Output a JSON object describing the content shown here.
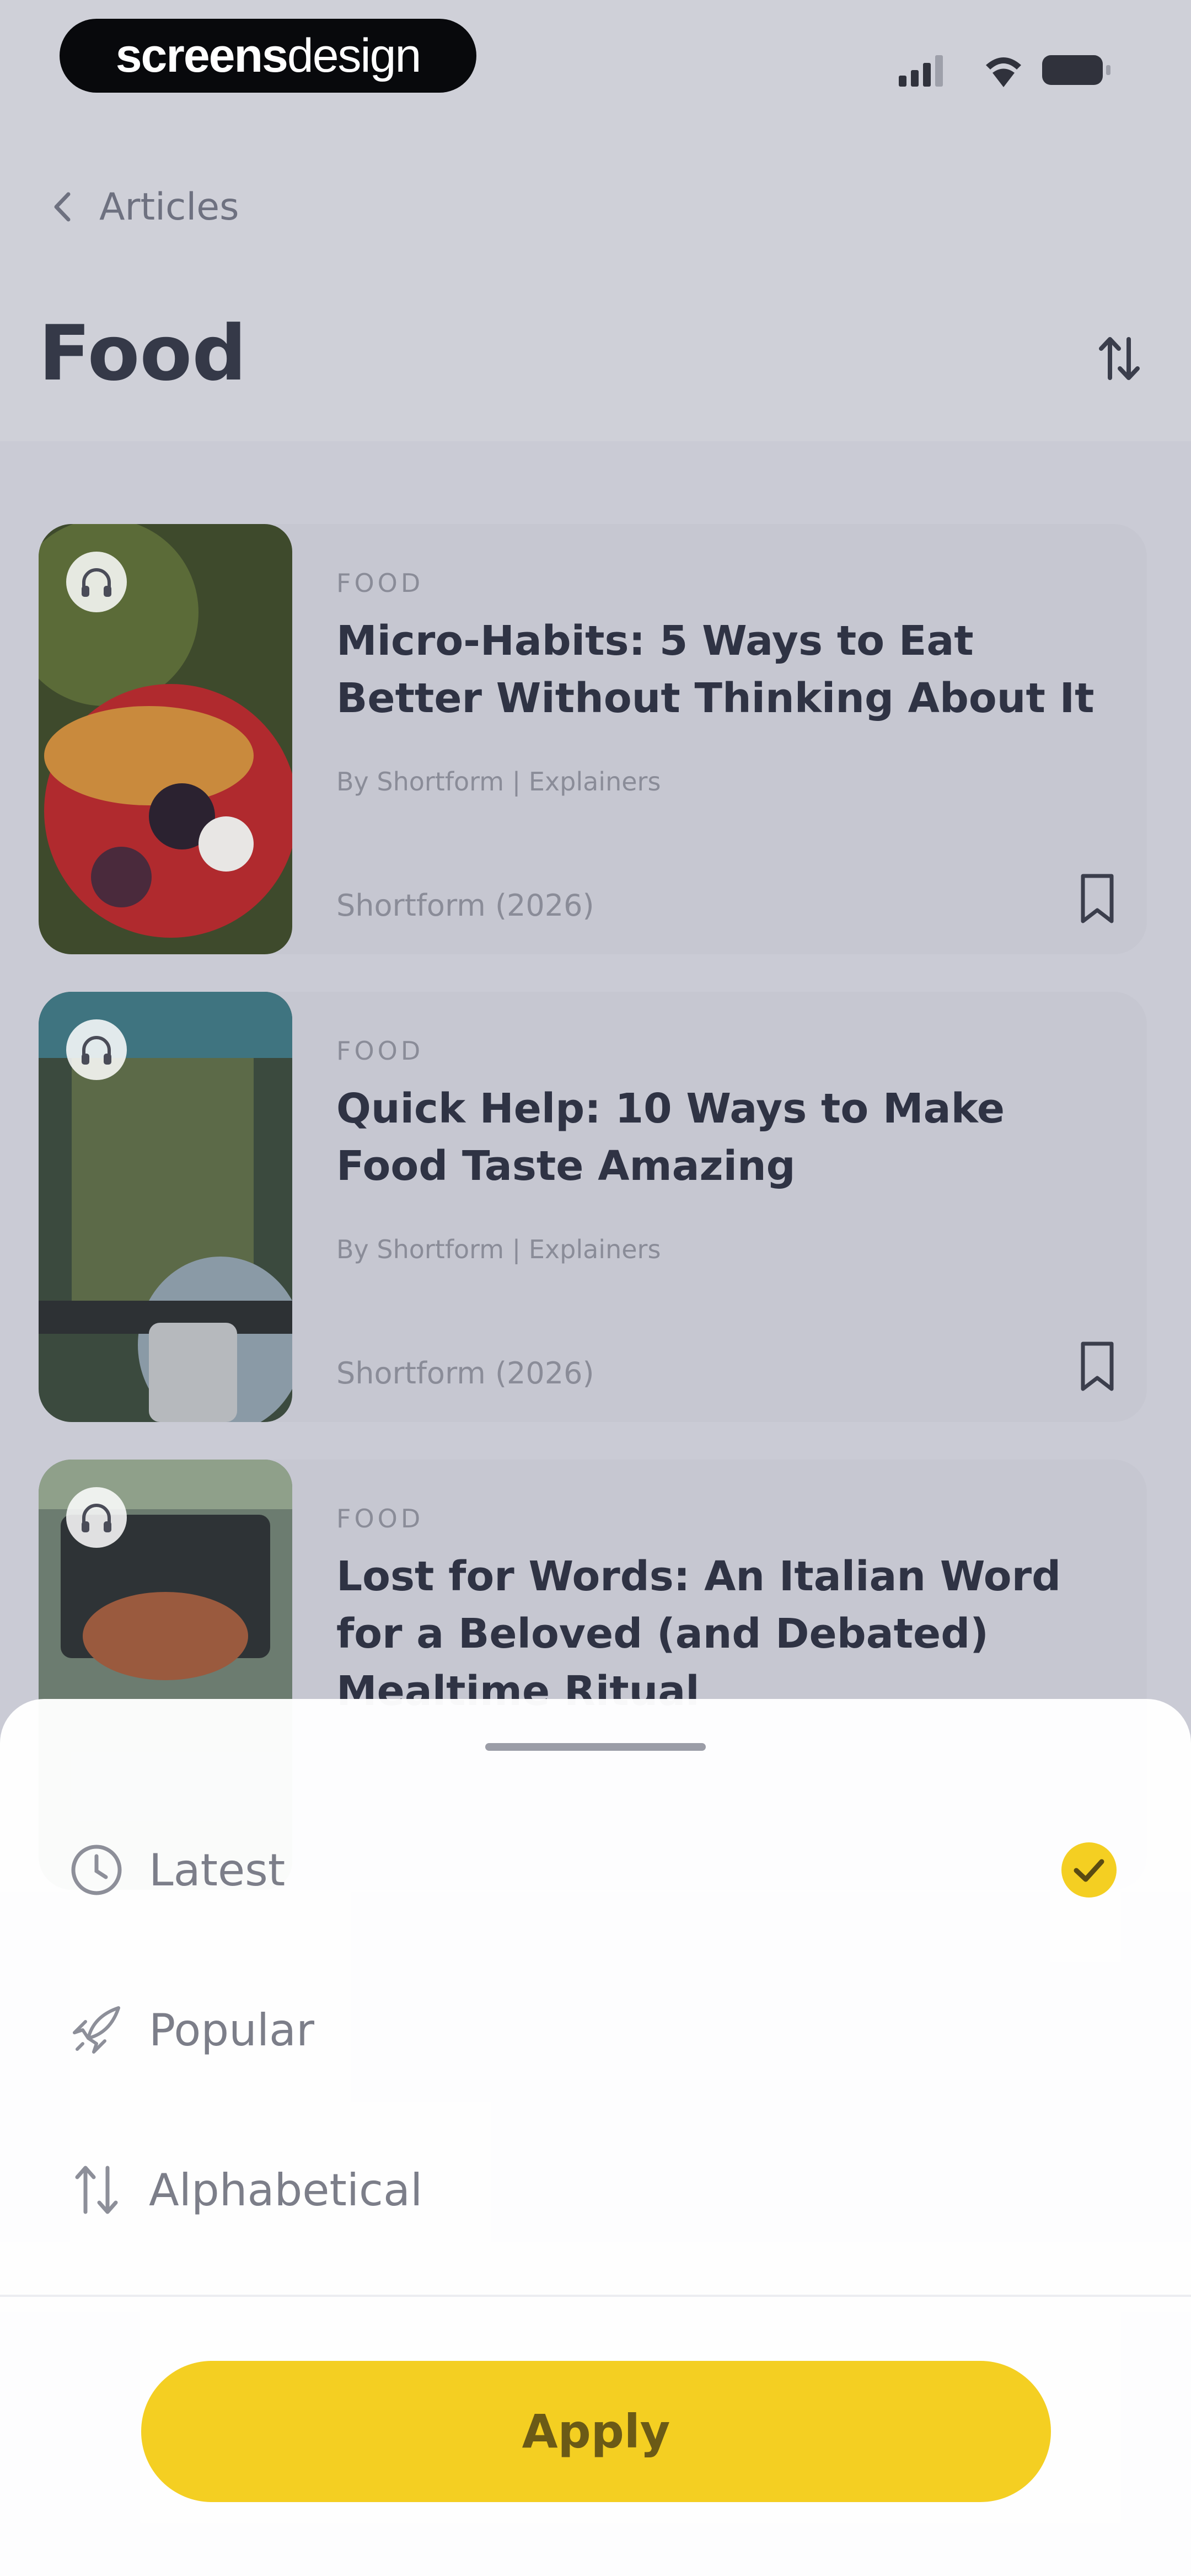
{
  "status_bar": {
    "brand": {
      "bold": "screens",
      "light": "design"
    },
    "icons": [
      "signal-icon",
      "wifi-icon",
      "battery-icon"
    ]
  },
  "nav": {
    "back_label": "Articles",
    "title": "Food",
    "sort_icon": "sort-icon"
  },
  "articles": [
    {
      "category": "FOOD",
      "title": "Micro-Habits: 5 Ways to Eat Better Without Thinking About It",
      "author": "By Shortform | Explainers",
      "source": "Shortform (2026)",
      "audio_icon": "headphones-icon",
      "bookmark_icon": "bookmark-icon"
    },
    {
      "category": "FOOD",
      "title": "Quick Help: 10 Ways to Make Food Taste Amazing",
      "author": "By Shortform | Explainers",
      "source": "Shortform (2026)",
      "audio_icon": "headphones-icon",
      "bookmark_icon": "bookmark-icon"
    },
    {
      "category": "FOOD",
      "title": "Lost for Words: An Italian Word for a Beloved (and Debated) Mealtime Ritual",
      "author": "",
      "source": "",
      "audio_icon": "headphones-icon",
      "bookmark_icon": "bookmark-icon"
    }
  ],
  "sort_sheet": {
    "options": [
      {
        "label": "Latest",
        "icon": "clock-icon",
        "selected": true
      },
      {
        "label": "Popular",
        "icon": "rocket-icon",
        "selected": false
      },
      {
        "label": "Alphabetical",
        "icon": "sort-arrows-icon",
        "selected": false
      }
    ],
    "apply_label": "Apply"
  },
  "colors": {
    "accent": "#f4cf22",
    "overlay": "#cfd0d8",
    "sheet": "#ffffff"
  }
}
